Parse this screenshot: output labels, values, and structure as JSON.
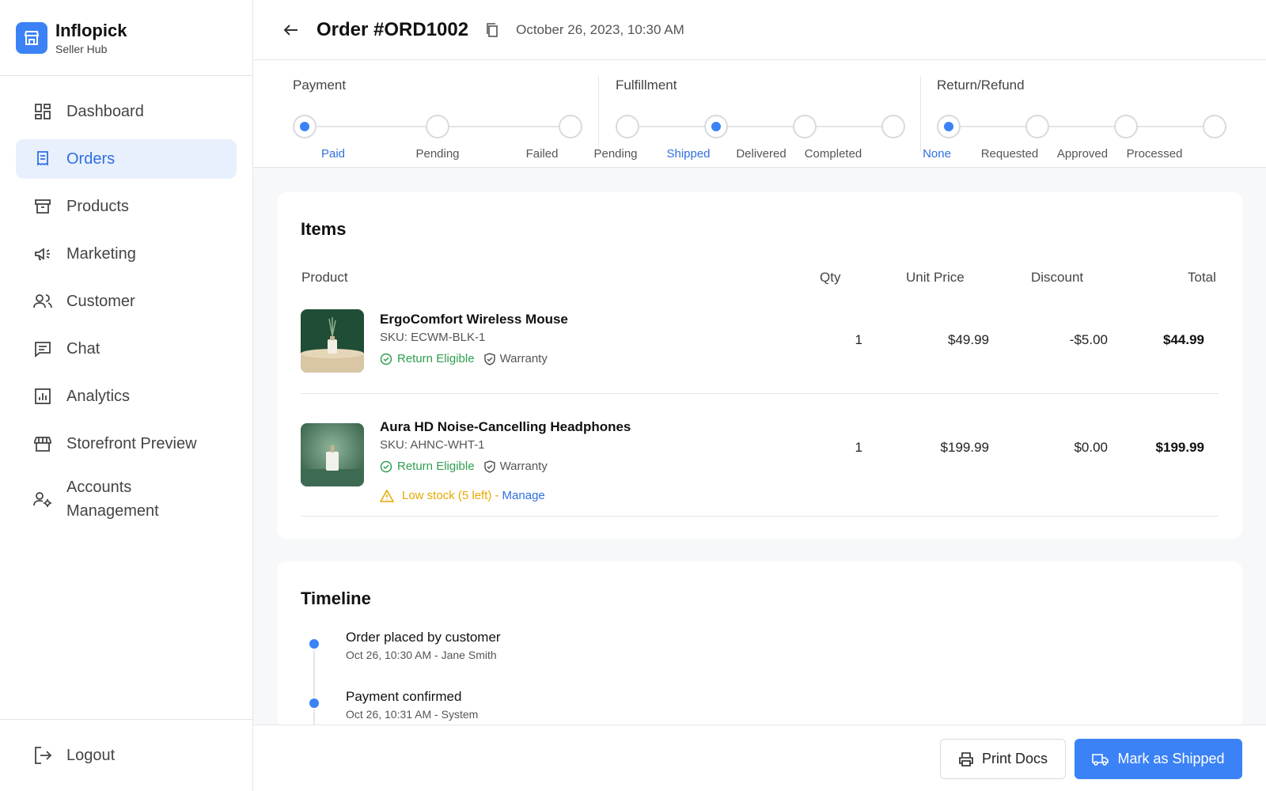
{
  "brand": {
    "name": "Inflopick",
    "subtitle": "Seller Hub"
  },
  "nav": [
    {
      "label": "Dashboard",
      "icon": "dashboard-icon"
    },
    {
      "label": "Orders",
      "icon": "orders-icon",
      "active": true
    },
    {
      "label": "Products",
      "icon": "archive-icon"
    },
    {
      "label": "Marketing",
      "icon": "megaphone-icon"
    },
    {
      "label": "Customer",
      "icon": "users-icon"
    },
    {
      "label": "Chat",
      "icon": "chat-icon"
    },
    {
      "label": "Analytics",
      "icon": "analytics-icon"
    },
    {
      "label": "Storefront Preview",
      "icon": "storefront-icon"
    },
    {
      "label": "Accounts Management",
      "icon": "user-settings-icon"
    }
  ],
  "logout": "Logout",
  "header": {
    "order_title": "Order #ORD1002",
    "date": "October 26, 2023, 10:30 AM"
  },
  "status": {
    "payment": {
      "title": "Payment",
      "steps": [
        "Paid",
        "Pending",
        "Failed"
      ],
      "active": "Paid"
    },
    "fulfillment": {
      "title": "Fulfillment",
      "steps": [
        "Pending",
        "Shipped",
        "Delivered",
        "Completed"
      ],
      "active": "Shipped"
    },
    "return": {
      "title": "Return/Refund",
      "steps": [
        "None",
        "Requested",
        "Approved",
        "Processed"
      ],
      "active": "None"
    }
  },
  "items": {
    "title": "Items",
    "columns": {
      "product": "Product",
      "qty": "Qty",
      "unit_price": "Unit Price",
      "discount": "Discount",
      "total": "Total"
    },
    "rows": [
      {
        "name": "ErgoComfort Wireless Mouse",
        "sku": "SKU: ECWM-BLK-1",
        "return_tag": "Return Eligible",
        "warranty_tag": "Warranty",
        "qty": "1",
        "unit_price": "$49.99",
        "discount": "-$5.00",
        "total": "$44.99"
      },
      {
        "name": "Aura HD Noise-Cancelling Headphones",
        "sku": "SKU: AHNC-WHT-1",
        "return_tag": "Return Eligible",
        "warranty_tag": "Warranty",
        "qty": "1",
        "unit_price": "$199.99",
        "discount": "$0.00",
        "total": "$199.99",
        "low_stock": "Low stock (5 left) -",
        "manage": "Manage"
      }
    ]
  },
  "timeline": {
    "title": "Timeline",
    "events": [
      {
        "title": "Order placed by customer",
        "meta": "Oct 26, 10:30 AM - Jane Smith"
      },
      {
        "title": "Payment confirmed",
        "meta": "Oct 26, 10:31 AM - System"
      }
    ]
  },
  "footer": {
    "print_label": "Print Docs",
    "ship_label": "Mark as Shipped"
  },
  "colors": {
    "accent": "#3b82f6",
    "success": "#2e9e4f",
    "warning": "#e6a700"
  }
}
